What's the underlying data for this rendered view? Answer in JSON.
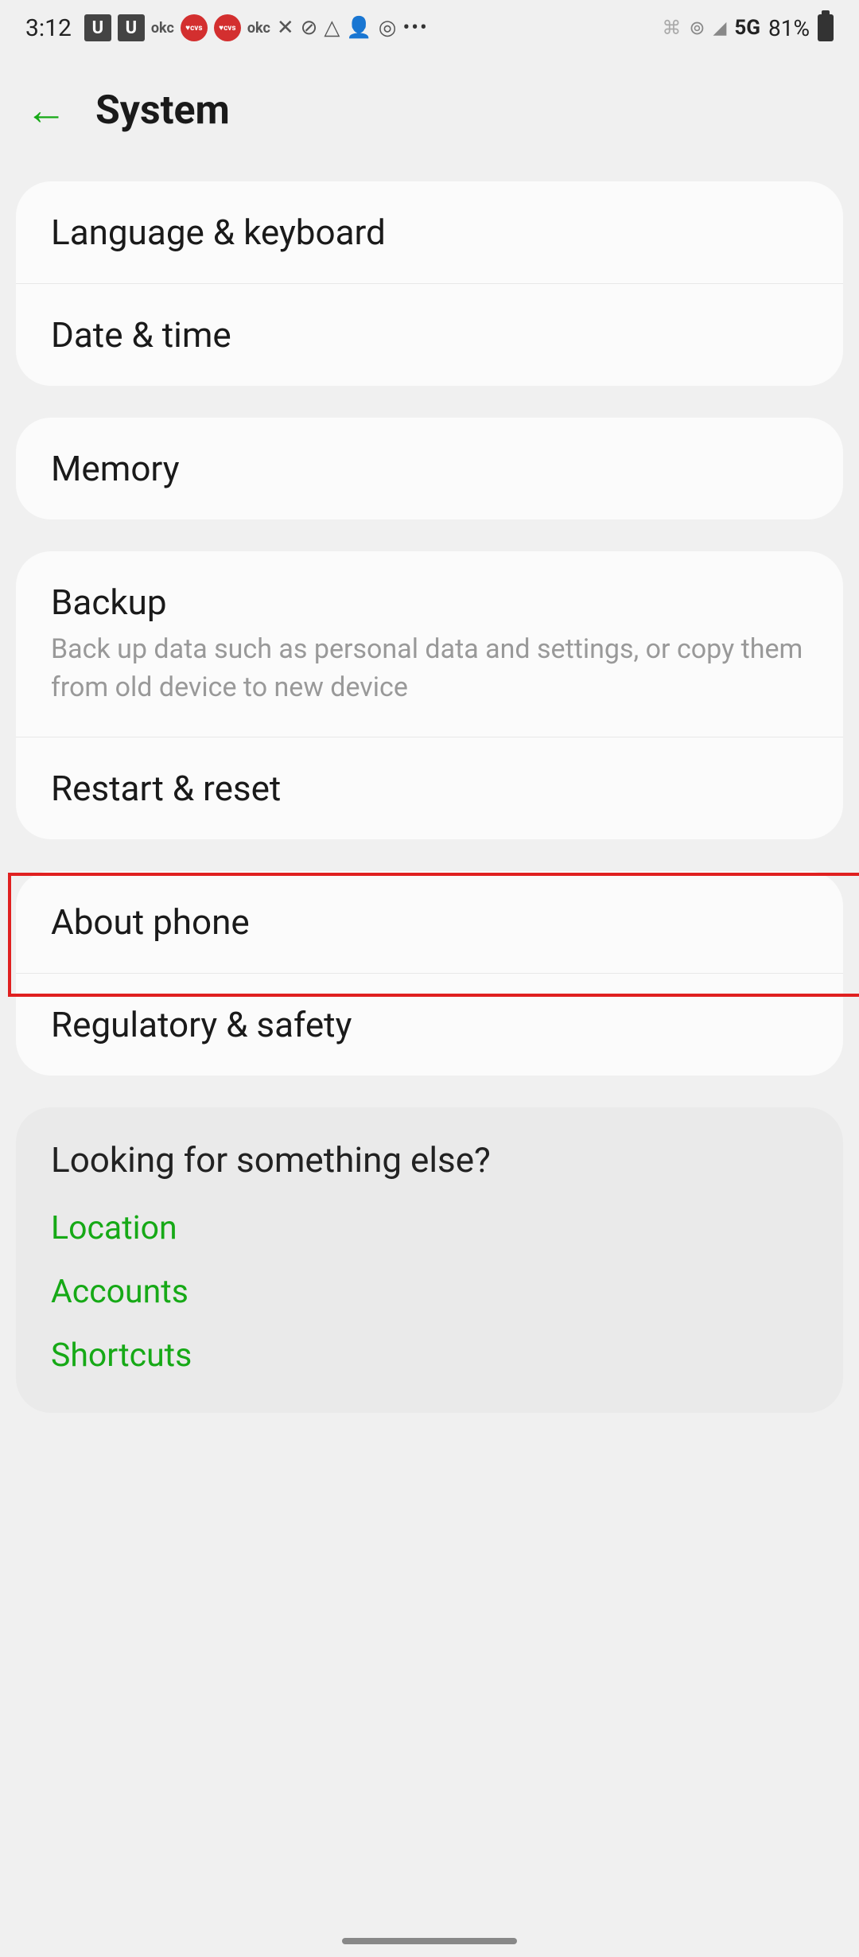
{
  "status": {
    "time": "3:12",
    "network": "5G",
    "battery_pct": "81%"
  },
  "header": {
    "title": "System"
  },
  "groups": [
    {
      "items": [
        {
          "title": "Language & keyboard"
        },
        {
          "title": "Date & time"
        }
      ]
    },
    {
      "items": [
        {
          "title": "Memory"
        }
      ]
    },
    {
      "items": [
        {
          "title": "Backup",
          "subtitle": "Back up data such as personal data and settings, or copy them from old device to new device"
        },
        {
          "title": "Restart & reset"
        }
      ]
    },
    {
      "items": [
        {
          "title": "About phone"
        },
        {
          "title": "Regulatory & safety"
        }
      ]
    }
  ],
  "help": {
    "title": "Looking for something else?",
    "links": [
      "Location",
      "Accounts",
      "Shortcuts"
    ]
  }
}
